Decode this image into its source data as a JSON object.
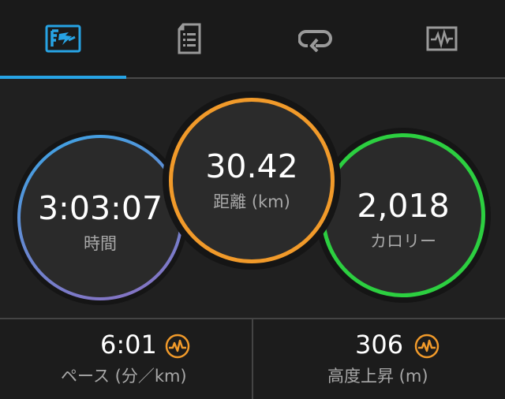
{
  "tabs": [
    {
      "icon": "stopwatch-running-icon",
      "active": true
    },
    {
      "icon": "list-document-icon",
      "active": false
    },
    {
      "icon": "lap-loop-icon",
      "active": false
    },
    {
      "icon": "activity-graph-icon",
      "active": false
    }
  ],
  "colors": {
    "tab_active": "#27a3e4",
    "time_ring_start": "#3aa6e6",
    "time_ring_end": "#8a6fc1",
    "distance_ring": "#f19a2a",
    "calorie_ring": "#2ccf40",
    "stat_icon": "#f19a2a"
  },
  "summary": {
    "time": {
      "value": "3:03:07",
      "label": "時間"
    },
    "distance": {
      "value": "30.42",
      "label": "距離 (km)"
    },
    "calories": {
      "value": "2,018",
      "label": "カロリー"
    }
  },
  "stats": {
    "pace": {
      "value": "6:01",
      "label": "ペース (分／km)",
      "icon": "pulse-graph-icon"
    },
    "elevation": {
      "value": "306",
      "label": "高度上昇 (m)",
      "icon": "pulse-graph-icon"
    }
  }
}
